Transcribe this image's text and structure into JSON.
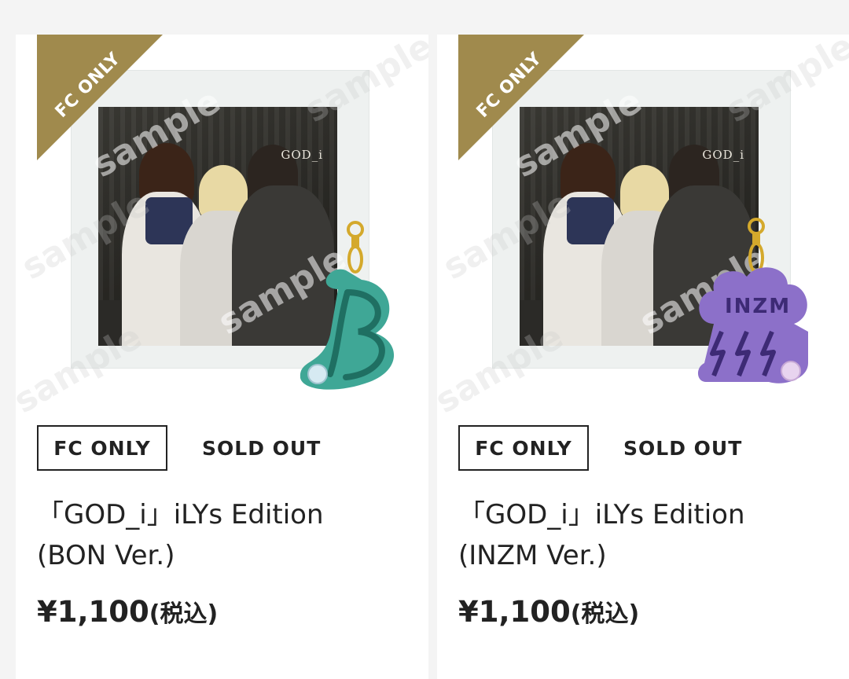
{
  "products": [
    {
      "ribbon": "FC ONLY",
      "watermark": "sample",
      "album_logo": "GOD_i",
      "badge": "FC ONLY",
      "status": "SOLD OUT",
      "title_line1": "「GOD_i」iLYs Edition",
      "title_line2": "(BON Ver.)",
      "price": "¥1,100",
      "price_tax": "(税込)",
      "charm_icon": "letter-b-charm-icon",
      "charm_color": "#3fa796"
    },
    {
      "ribbon": "FC ONLY",
      "watermark": "sample",
      "album_logo": "GOD_i",
      "badge": "FC ONLY",
      "status": "SOLD OUT",
      "title_line1": "「GOD_i」iLYs Edition",
      "title_line2": "(INZM Ver.)",
      "price": "¥1,100",
      "price_tax": "(税込)",
      "charm_icon": "cloud-lightning-charm-icon",
      "charm_color": "#8c70c9"
    }
  ],
  "colors": {
    "ribbon_gold": "#a08a4d",
    "background": "#f4f4f4",
    "card": "#ffffff",
    "text": "#222222"
  }
}
